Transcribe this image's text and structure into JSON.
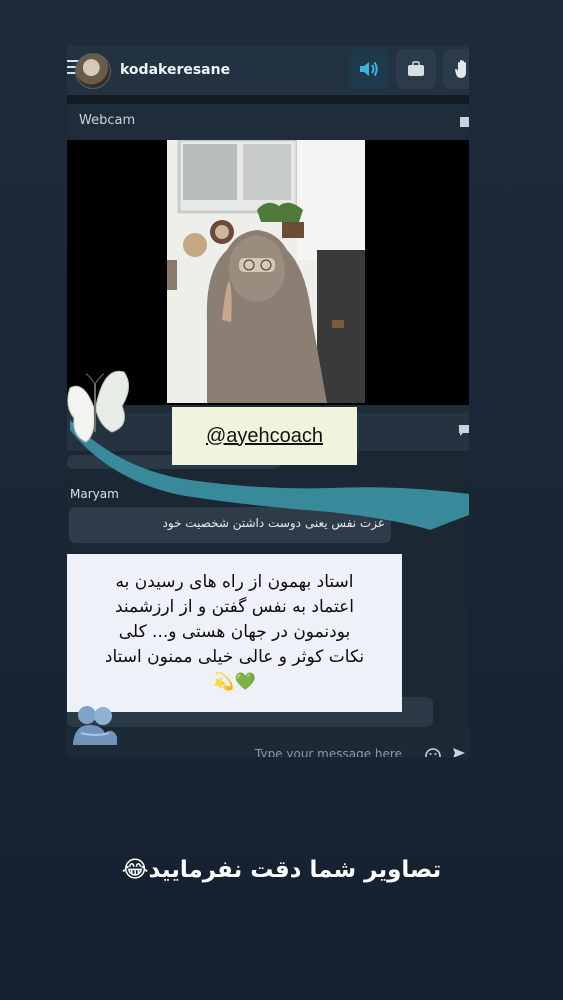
{
  "header": {
    "username": "kodakeresane",
    "buttons": [
      {
        "icon": "speaker-icon",
        "active": true
      },
      {
        "icon": "briefcase-icon",
        "active": false
      },
      {
        "icon": "hand-icon",
        "active": false
      }
    ]
  },
  "webcam": {
    "label": "Webcam"
  },
  "sticker": {
    "handle": "@ayehcoach"
  },
  "chat": {
    "sender": "Maryam",
    "message": "عزت نفس یعنی دوست داشتن شخصیت خود",
    "note_line1": "استاد بهمون از راه های رسیدن به",
    "note_line2": "اعتماد به نفس گفتن و از ارزشمند",
    "note_line3": "بودنمون  در جهان هستی  و... کلی",
    "note_line4": "نکات کوثر و عالی خیلی ممنون استاد",
    "note_emoji": "💚💫",
    "input_placeholder": "Type your message here"
  },
  "caption": "تصاویر شما دقت نفرمایید😂",
  "colors": {
    "accent": "#2f8fb0",
    "ribbon": "#3a8fa0",
    "background": "#1b2838"
  }
}
